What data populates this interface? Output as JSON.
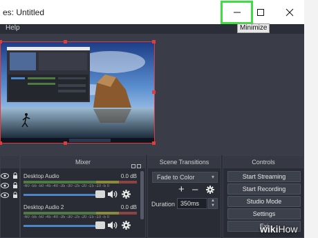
{
  "window": {
    "title": "es: Untitled",
    "tooltip": "Minimize"
  },
  "menu": {
    "help_label": "Help"
  },
  "icons": {
    "minimize": "minimize-icon",
    "maximize": "maximize-icon",
    "close": "close-icon",
    "eye": "eye-icon",
    "lock": "lock-icon",
    "speaker": "speaker-icon",
    "gear": "gear-icon",
    "plus": "plus-icon",
    "minus": "minus-icon"
  },
  "colors": {
    "highlight": "#3ce03c",
    "selection": "#e23b3b",
    "slider": "#4a86c9"
  },
  "mixer": {
    "title": "Mixer",
    "channels": [
      {
        "name": "Desktop Audio",
        "level": "0.0 dB",
        "volume": 1.0
      },
      {
        "name": "Desktop Audio 2",
        "level": "0.0 dB",
        "volume": 1.0
      }
    ],
    "ticks": "-60 -55 -50 -45 -40 -35 -30 -25 -20 -15 -10 -5 0"
  },
  "transitions": {
    "title": "Scene Transitions",
    "selected": "Fade to Color",
    "duration_label": "Duration",
    "duration_value": "350ms",
    "add": "+",
    "remove": "–"
  },
  "controls": {
    "title": "Controls",
    "buttons": [
      "Start Streaming",
      "Start Recording",
      "Studio Mode",
      "Settings",
      "Exi"
    ]
  },
  "watermark": {
    "brand_wiki": "wiki",
    "brand_how": "How"
  }
}
